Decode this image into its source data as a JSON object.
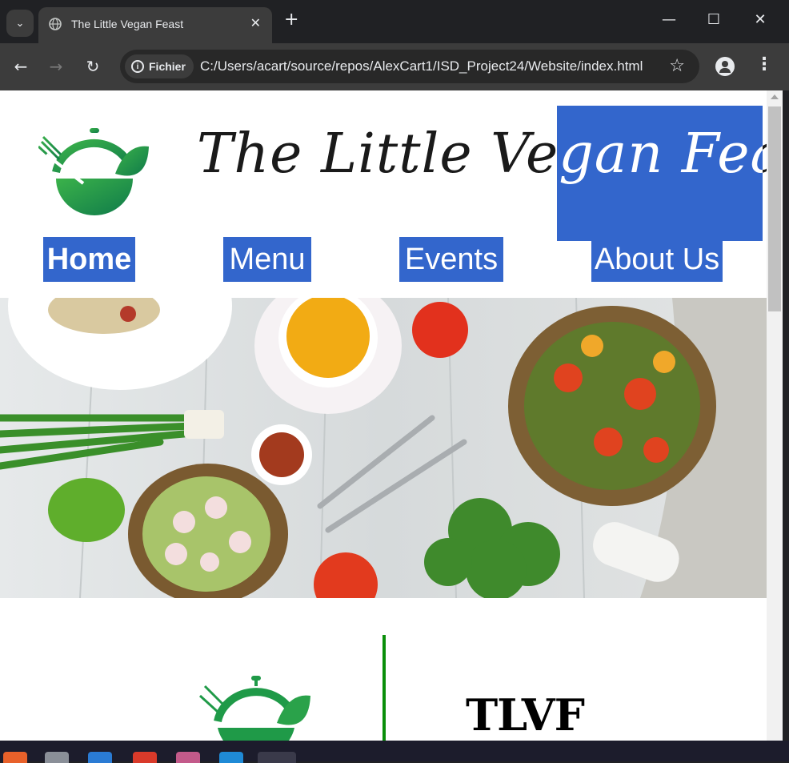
{
  "browser": {
    "tab_title": "The Little Vegan Feast",
    "tab_close": "✕",
    "new_tab": "+",
    "security_chip": "Fichier",
    "url": "C:/Users/acart/source/repos/AlexCart1/ISD_Project24/Website/index.html",
    "controls": {
      "minimize": "—",
      "maximize": "☐",
      "close": "✕"
    }
  },
  "site": {
    "title": "The Little Vegan Feast",
    "nav": [
      {
        "label": "Home"
      },
      {
        "label": "Menu"
      },
      {
        "label": "Events"
      },
      {
        "label": "About Us"
      }
    ],
    "section_heading": "TLVF",
    "colors": {
      "highlight": "#3366cc",
      "brand_green": "#1f9a48",
      "divider_green": "#0a8f0a"
    }
  },
  "icons": [
    "tab-search-icon",
    "globe-icon",
    "back-icon",
    "forward-icon",
    "reload-icon",
    "info-icon",
    "star-icon",
    "profile-icon",
    "menu-icon",
    "logo-icon"
  ],
  "taskbar": [
    "app-icon",
    "settings-app-icon",
    "vscode-app-icon",
    "chrome-app-icon",
    "git-app-icon",
    "vscode-app-icon",
    "chrome-app-icon"
  ]
}
